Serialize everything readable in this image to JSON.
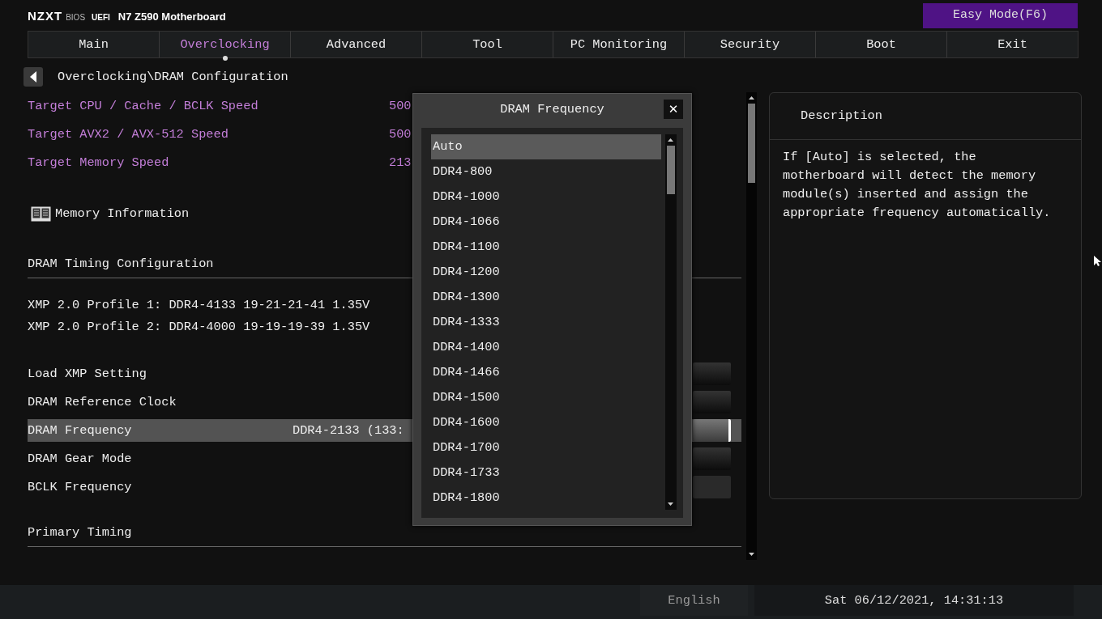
{
  "header": {
    "brand": "NZXT",
    "bios_label": "BIOS",
    "uefi_label": "UEFI",
    "model": "N7 Z590 Motherboard",
    "mode_button": "Easy Mode(F6)"
  },
  "tabs": [
    {
      "label": "Main",
      "selected": false
    },
    {
      "label": "Overclocking",
      "selected": true
    },
    {
      "label": "Advanced",
      "selected": false
    },
    {
      "label": "Tool",
      "selected": false
    },
    {
      "label": "PC Monitoring",
      "selected": false
    },
    {
      "label": "Security",
      "selected": false
    },
    {
      "label": "Boot",
      "selected": false
    },
    {
      "label": "Exit",
      "selected": false
    }
  ],
  "breadcrumb": "Overclocking\\DRAM Configuration",
  "items": [
    {
      "kind": "info",
      "label": "Target CPU / Cache / BCLK Speed",
      "value": "500"
    },
    {
      "kind": "info",
      "label": "Target AVX2 / AVX-512 Speed",
      "value": "500"
    },
    {
      "kind": "info",
      "label": "Target Memory Speed",
      "value": "213"
    },
    {
      "kind": "submenu",
      "label": "Memory Information"
    },
    {
      "kind": "heading",
      "label": "DRAM Timing Configuration"
    },
    {
      "kind": "note",
      "label": "XMP 2.0 Profile 1: DDR4-4133 19-21-21-41 1.35V"
    },
    {
      "kind": "note",
      "label": "XMP 2.0 Profile 2: DDR4-4000 19-19-19-39 1.35V"
    },
    {
      "kind": "setting",
      "label": "Load XMP Setting",
      "selected": false,
      "disabled": false
    },
    {
      "kind": "setting",
      "label": "DRAM Reference Clock",
      "selected": false,
      "disabled": false
    },
    {
      "kind": "setting",
      "label": "DRAM Frequency",
      "value": "DDR4-2133 (133:",
      "selected": true,
      "disabled": false
    },
    {
      "kind": "setting",
      "label": "DRAM Gear Mode",
      "selected": false,
      "disabled": false
    },
    {
      "kind": "setting",
      "label": "BCLK Frequency",
      "selected": false,
      "disabled": true
    },
    {
      "kind": "heading",
      "label": "Primary Timing"
    }
  ],
  "description": {
    "title": "Description",
    "text": "If [Auto] is selected, the motherboard will detect the memory module(s) inserted and assign the appropriate frequency automatically."
  },
  "popup": {
    "title": "DRAM Frequency",
    "close": "✕",
    "options": [
      {
        "label": "Auto",
        "selected": true
      },
      {
        "label": "DDR4-800",
        "selected": false
      },
      {
        "label": "DDR4-1000",
        "selected": false
      },
      {
        "label": "DDR4-1066",
        "selected": false
      },
      {
        "label": "DDR4-1100",
        "selected": false
      },
      {
        "label": "DDR4-1200",
        "selected": false
      },
      {
        "label": "DDR4-1300",
        "selected": false
      },
      {
        "label": "DDR4-1333",
        "selected": false
      },
      {
        "label": "DDR4-1400",
        "selected": false
      },
      {
        "label": "DDR4-1466",
        "selected": false
      },
      {
        "label": "DDR4-1500",
        "selected": false
      },
      {
        "label": "DDR4-1600",
        "selected": false
      },
      {
        "label": "DDR4-1700",
        "selected": false
      },
      {
        "label": "DDR4-1733",
        "selected": false
      },
      {
        "label": "DDR4-1800",
        "selected": false
      }
    ]
  },
  "status_bar": {
    "language": "English",
    "datetime": "Sat 06/12/2021, 14:31:13"
  }
}
